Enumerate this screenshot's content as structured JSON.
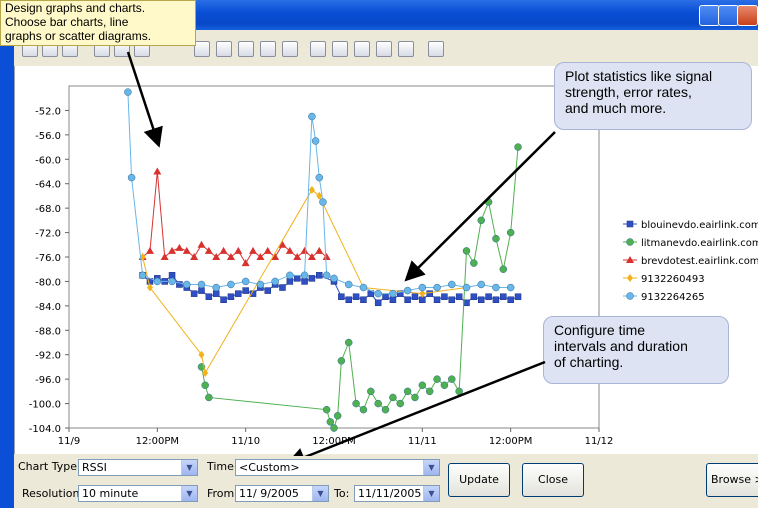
{
  "window": {
    "title": ""
  },
  "callouts": {
    "design": [
      "Design graphs and charts.",
      "Choose bar charts, line",
      "graphs or scatter diagrams."
    ],
    "plot": [
      "Plot statistics like signal",
      "strength, error rates,",
      "and much more."
    ],
    "configure": [
      "Configure time",
      "intervals and duration",
      "of charting."
    ]
  },
  "controls": {
    "chart_type_label": "Chart Type:",
    "chart_type_value": "RSSI",
    "time_label": "Time:",
    "time_value": "<Custom>",
    "resolution_label": "Resolution:",
    "resolution_value": "10 minute",
    "from_label": "From:",
    "from_value": "11/ 9/2005",
    "to_label": "To:",
    "to_value": "11/11/2005",
    "update_label": "Update",
    "close_label": "Close",
    "browse_label": "Browse >>"
  },
  "chart_data": {
    "type": "scatter",
    "ylim": [
      -104.0,
      -48.0
    ],
    "yticks": [
      "-52.0",
      "-56.0",
      "-60.0",
      "-64.0",
      "-68.0",
      "-72.0",
      "-76.0",
      "-80.0",
      "-84.0",
      "-88.0",
      "-92.0",
      "-96.0",
      "-100.0",
      "-104.0"
    ],
    "xticks": [
      "11/9",
      "12:00PM",
      "11/10",
      "12:00PM",
      "11/11",
      "12:00PM",
      "11/12"
    ],
    "xlim": [
      0,
      72
    ],
    "series": [
      {
        "name": "blouinevdo.eairlink.com",
        "color": "#2f4fc4",
        "marker": "square",
        "x": [
          10,
          11,
          12,
          13,
          14,
          15,
          16,
          17,
          18,
          19,
          20,
          21,
          22,
          23,
          24,
          25,
          26,
          27,
          28,
          29,
          30,
          31,
          32,
          33,
          34,
          36,
          37,
          38,
          39,
          40,
          41,
          42,
          43,
          44,
          45,
          46,
          47,
          48,
          49,
          50,
          51,
          52,
          53,
          54,
          55,
          56,
          57,
          58,
          59,
          60,
          61
        ],
        "y": [
          -79,
          -80,
          -79.5,
          -80,
          -79,
          -80.5,
          -81,
          -82,
          -81.5,
          -82.5,
          -82,
          -83,
          -82.5,
          -82,
          -81.5,
          -82,
          -81,
          -81.5,
          -80.5,
          -81,
          -80,
          -79.5,
          -80,
          -79.5,
          -79,
          -80,
          -82.5,
          -83,
          -82.5,
          -83,
          -82,
          -83.5,
          -82.5,
          -83,
          -82,
          -83,
          -82.5,
          -83,
          -82,
          -83,
          -82.5,
          -83,
          -82.5,
          -83.5,
          -82.5,
          -83,
          -82.5,
          -83,
          -82.5,
          -83,
          -82.5
        ]
      },
      {
        "name": "litmanevdo.eairlink.com",
        "color": "#4fb04f",
        "marker": "circle",
        "x": [
          18,
          18.5,
          19,
          35,
          35.5,
          36,
          36.5,
          37,
          38,
          39,
          40,
          41,
          42,
          43,
          44,
          45,
          46,
          47,
          48,
          49,
          50,
          51,
          52,
          53,
          54,
          55,
          56,
          57,
          58,
          59,
          60,
          61
        ],
        "y": [
          -94,
          -97,
          -99,
          -101,
          -103,
          -104,
          -102,
          -93,
          -90,
          -100,
          -101,
          -98,
          -100,
          -101,
          -99,
          -100,
          -98,
          -99,
          -97,
          -98,
          -96,
          -97,
          -96,
          -98,
          -75,
          -77,
          -70,
          -67,
          -73,
          -78,
          -72,
          -58
        ]
      },
      {
        "name": "brevdotest.eairlink.com",
        "color": "#d8322f",
        "marker": "triangle",
        "x": [
          10,
          11,
          12,
          13,
          14,
          15,
          16,
          17,
          18,
          19,
          20,
          21,
          22,
          23,
          24,
          25,
          26,
          27,
          28,
          29,
          30,
          31,
          32,
          33,
          34,
          35
        ],
        "y": [
          -76,
          -75,
          -62,
          -76,
          -75,
          -74.5,
          -75,
          -76,
          -74,
          -75,
          -76,
          -75,
          -76,
          -75,
          -77,
          -75,
          -76,
          -75,
          -76,
          -74,
          -75,
          -76,
          -75,
          -76,
          -75,
          -76
        ]
      },
      {
        "name": "9132260493",
        "color": "#f1b21d",
        "marker": "diamond",
        "x": [
          10,
          11,
          18,
          18.5,
          33,
          34,
          40,
          48,
          54
        ],
        "y": [
          -76,
          -81,
          -92,
          -95,
          -65,
          -66,
          -81,
          -82,
          -81
        ]
      },
      {
        "name": "9132264265",
        "color": "#69b6e8",
        "marker": "circle",
        "x": [
          8,
          8.5,
          10,
          12,
          14,
          16,
          18,
          20,
          22,
          24,
          26,
          28,
          30,
          32,
          33,
          33.5,
          34,
          34.5,
          35,
          36,
          38,
          40,
          42,
          44,
          46,
          48,
          50,
          52,
          54,
          56,
          58,
          60
        ],
        "y": [
          -49,
          -63,
          -79,
          -80,
          -80,
          -80.5,
          -80.5,
          -81,
          -80.5,
          -80,
          -80.5,
          -80,
          -79,
          -79,
          -53,
          -57,
          -63,
          -67,
          -79,
          -79.5,
          -80.5,
          -81,
          -82,
          -82,
          -81.5,
          -81,
          -81,
          -80.5,
          -81,
          -80.5,
          -81,
          -81
        ]
      }
    ]
  }
}
